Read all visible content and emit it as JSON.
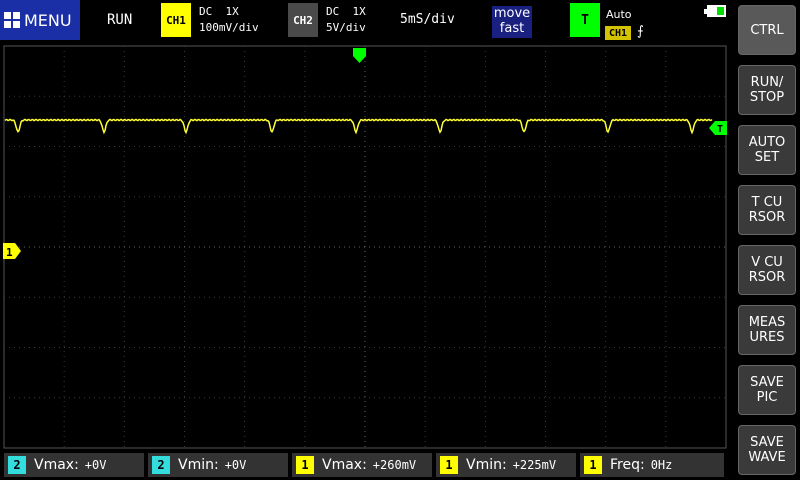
{
  "top_bar": {
    "menu_label": "MENU",
    "run_state": "RUN",
    "ch1": {
      "badge": "CH1",
      "coupling": "DC  1X",
      "scale": "100mV/div",
      "color": "#ffff00"
    },
    "ch2": {
      "badge": "CH2",
      "coupling": "DC  1X",
      "scale": "5V/div",
      "color": "#4a4a4a"
    },
    "timebase": "5mS/div",
    "move_mode": {
      "line1": "move",
      "line2": "fast"
    },
    "trigger": {
      "badge": "T",
      "mode": "Auto",
      "source": "CH1",
      "edge_symbol": "⨍",
      "color": "#00ff00"
    },
    "battery_icon": "battery-icon"
  },
  "sidebar": {
    "buttons": [
      {
        "label1": "CTRL",
        "label2": ""
      },
      {
        "label1": "RUN/",
        "label2": "STOP"
      },
      {
        "label1": "AUTO",
        "label2": "SET"
      },
      {
        "label1": "T CU",
        "label2": "RSOR"
      },
      {
        "label1": "V CU",
        "label2": "RSOR"
      },
      {
        "label1": "MEAS",
        "label2": "URES"
      },
      {
        "label1": "SAVE",
        "label2": "PIC"
      },
      {
        "label1": "SAVE",
        "label2": "WAVE"
      }
    ]
  },
  "markers": {
    "ch1_level": "1",
    "trigger_level": "T"
  },
  "measurements": [
    {
      "channel": "2",
      "name": "Vmax:",
      "value": "+0V",
      "color": "#33dddd"
    },
    {
      "channel": "2",
      "name": "Vmin:",
      "value": "+0V",
      "color": "#33dddd"
    },
    {
      "channel": "1",
      "name": "Vmax:",
      "value": "+260mV",
      "color": "#ffff00"
    },
    {
      "channel": "1",
      "name": "Vmin:",
      "value": "+225mV",
      "color": "#ffff00"
    },
    {
      "channel": "1",
      "name": "Freq:",
      "value": "0Hz",
      "color": "#ffff00"
    }
  ],
  "colors": {
    "trace": "#ffff33",
    "grid": "#3a3a3a",
    "trigger": "#00ff00",
    "ch1": "#ffff00"
  }
}
